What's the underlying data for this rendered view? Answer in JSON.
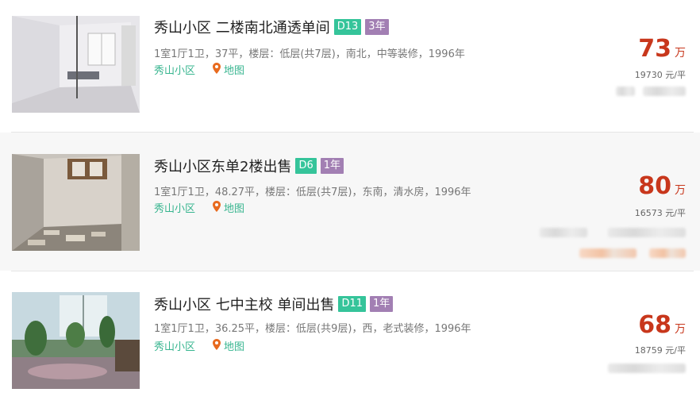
{
  "listings": [
    {
      "title": "秀山小区 二楼南北通透单间",
      "tag_code": "D13",
      "tag_age": "3年",
      "meta": "1室1厅1卫，37平，楼层：低层(共7层)，南北，中等装修，1996年",
      "community": "秀山小区",
      "map_label": "地图",
      "price": "73",
      "price_unit": "万",
      "unit_price": "19730 元/平"
    },
    {
      "title": "秀山小区东单2楼出售",
      "tag_code": "D6",
      "tag_age": "1年",
      "meta": "1室1厅1卫，48.27平，楼层：低层(共7层)，东南，清水房，1996年",
      "community": "秀山小区",
      "map_label": "地图",
      "price": "80",
      "price_unit": "万",
      "unit_price": "16573 元/平"
    },
    {
      "title": "秀山小区 七中主校 单间出售",
      "tag_code": "D11",
      "tag_age": "1年",
      "meta": "1室1厅1卫，36.25平，楼层：低层(共9层)，西，老式装修，1996年",
      "community": "秀山小区",
      "map_label": "地图",
      "price": "68",
      "price_unit": "万",
      "unit_price": "18759 元/平"
    }
  ],
  "colors": {
    "price": "#c8371c",
    "tag_code_bg": "#35c49a",
    "tag_age_bg": "#a27fb3",
    "link": "#37b58f",
    "pin": "#e86a1e"
  },
  "icons": {
    "map": "location-pin-icon"
  }
}
